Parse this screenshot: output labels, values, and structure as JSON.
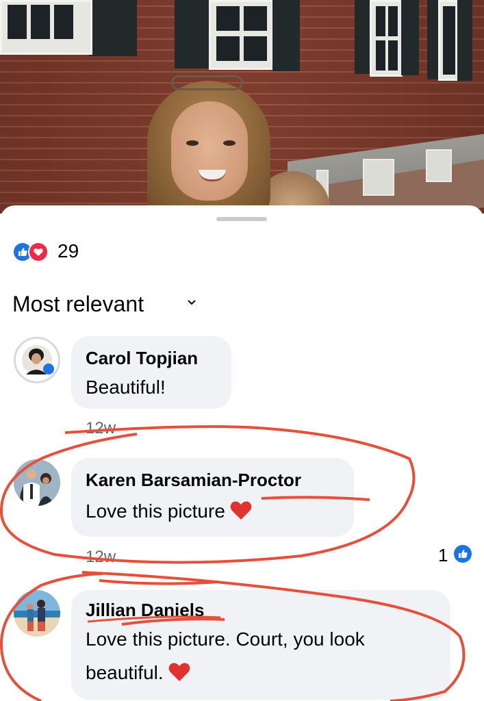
{
  "reactions": {
    "count": "29",
    "types": [
      "like-icon",
      "love-icon"
    ]
  },
  "sort": {
    "label": "Most relevant"
  },
  "comments": [
    {
      "author": "Carol Topjian",
      "text": "Beautiful!",
      "time": "12w",
      "has_heart": false
    },
    {
      "author": "Karen Barsamian-Proctor",
      "text": "Love this picture",
      "time": "12w",
      "has_heart": true,
      "likes": "1"
    },
    {
      "author": "Jillian Daniels",
      "text_line1": "Love this picture. Court, you look",
      "text_line2": "beautiful.",
      "has_heart": true
    }
  ],
  "colors": {
    "facebook_blue": "#1b74e4",
    "love_red": "#f0284a",
    "bubble": "#f0f2f5",
    "annotation": "#e4503a",
    "secondary_text": "#65676b"
  }
}
